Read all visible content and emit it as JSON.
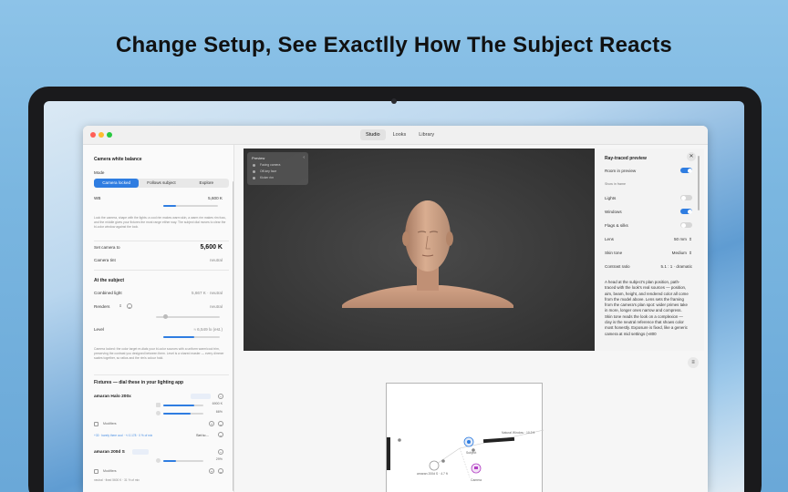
{
  "headline": "Change Setup, See Exactlly How The Subject Reacts",
  "window": {
    "tabs": [
      {
        "label": "Studio",
        "active": true
      },
      {
        "label": "Looks",
        "active": false
      },
      {
        "label": "Library",
        "active": false
      }
    ]
  },
  "sidebar": {
    "white_balance": {
      "title": "Camera white balance",
      "mode_label": "Mode",
      "modes": [
        "Camera locked",
        "Follows subject",
        "Explore"
      ],
      "wb_label": "WB",
      "wb_value": "5,600 K",
      "description": "Lock the camera, shape with the lights: a cool rim makes warm skin, a warm rim makes rim fuss, and the middle gives your fixtures the most range either way. The subject dial moves to clear the bi-color window against the look.",
      "set_camera_label": "Set camera to",
      "set_camera_value": "5,600 K",
      "tint_label": "Camera tint",
      "tint_value": "neutral"
    },
    "subject": {
      "title": "At the subject",
      "combined_label": "Combined light",
      "combined_value": "5,667 K · neutral",
      "renders_label": "Renders",
      "renders_value": "neutral",
      "level_label": "Level",
      "level_value": "≈ 6,549 lx (est.)",
      "description": "Camera locked: the color target re-dials your bi-color sources with a uniform warm/cool trim, preserving the contrast you designed between them. Level is a shared master — every dimmer scales together, so ratios and the rim's colour hold."
    },
    "fixtures": {
      "title": "Fixtures — dial these in your lighting app",
      "items": [
        {
          "name": "amaran Halo 200x",
          "cct": "6900 K",
          "intensity": "66%",
          "modifier": "Modifiers",
          "footnote": "+33 · barely there cool · +/-0.178 · 0 % of mix",
          "set_to": "Set to…"
        },
        {
          "name": "amaran 200d S",
          "intensity": "29%",
          "modifier": "Modifiers",
          "footnote": "neutral · fixed 5600 K · 31 % of mix"
        }
      ]
    }
  },
  "preview": {
    "overlay_title": "Preview",
    "overlay_items": [
      "Facing camera",
      "Off-key face",
      "Kicker rim"
    ],
    "panel": {
      "title": "Ray-traced preview",
      "room_label": "Room in preview",
      "show_in_frame": "Show in frame",
      "lights_label": "Lights",
      "windows_label": "Windows",
      "flags_label": "Flags & silks",
      "lens_label": "Lens",
      "lens_value": "50 mm",
      "skin_label": "Skin tone",
      "skin_value": "Medium",
      "contrast_label": "Contrast ratio",
      "contrast_value": "5.1 : 1 · dramatic",
      "paragraph": "A head at the subject's plan position, path-traced with the look's real sources — position, aim, beam, height, and rendered color all come from the model above. Lens sets the framing from the camera's plan spot: wider primes take in more, longer ones narrow and compress. Skin tone reads the look on a complexion — clay is the neutral reference that shows color most honestly. Exposure is fixed, like a generic camera at mid settings (≈800"
    },
    "toggles": {
      "room": true,
      "lights": false,
      "windows": true,
      "flags": false
    }
  },
  "diagram": {
    "subject_label": "Subject",
    "camera_label": "Camera",
    "window_label": "Natural Window · 10.3 ft",
    "fixture_label": "amaran 200d S · 4.7 ft"
  },
  "colors": {
    "accent": "#2f7de1",
    "camera_marker": "#b23fc4"
  }
}
